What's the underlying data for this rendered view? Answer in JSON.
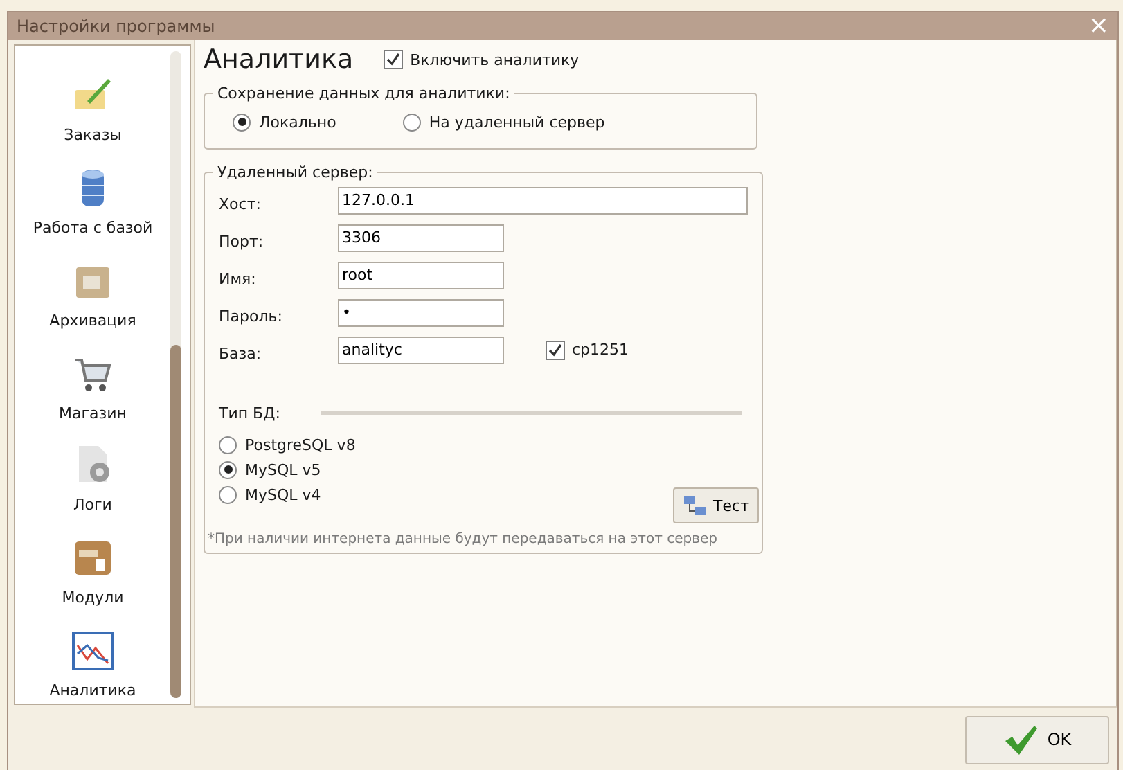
{
  "window": {
    "title": "Настройки программы",
    "close": "×"
  },
  "sidebar": {
    "items": [
      {
        "label": "Заказы",
        "kind": "orders"
      },
      {
        "label": "Работа с базой",
        "kind": "database"
      },
      {
        "label": "Архивация",
        "kind": "archive"
      },
      {
        "label": "Магазин",
        "kind": "cart"
      },
      {
        "label": "Логи",
        "kind": "logs"
      },
      {
        "label": "Модули",
        "kind": "modules"
      },
      {
        "label": "Аналитика",
        "kind": "chart"
      }
    ]
  },
  "page": {
    "title": "Аналитика",
    "enable": {
      "label": "Включить аналитику",
      "checked": true
    }
  },
  "storage": {
    "legend": "Сохранение данных для аналитики:",
    "options": [
      {
        "label": "Локально",
        "selected": true
      },
      {
        "label": "На удаленный сервер",
        "selected": false
      }
    ]
  },
  "server": {
    "legend": "Удаленный сервер:",
    "fields": [
      {
        "label": "Хост:",
        "value": "127.0.0.1"
      },
      {
        "label": "Порт:",
        "value": "3306"
      },
      {
        "label": "Имя:",
        "value": "root"
      },
      {
        "label": "Пароль:",
        "value": "•"
      },
      {
        "label": "База:",
        "value": "analityc"
      }
    ],
    "encoding": {
      "label": "cp1251",
      "checked": true
    },
    "db_type": {
      "label": "Тип БД:",
      "options": [
        {
          "label": "PostgreSQL v8",
          "selected": false
        },
        {
          "label": "MySQL v5",
          "selected": true
        },
        {
          "label": "MySQL v4",
          "selected": false
        }
      ]
    },
    "test_button": "Тест",
    "note": "*При наличии интернета данные будут передаваться на этот сервер"
  },
  "buttons": {
    "ok": "OK"
  }
}
